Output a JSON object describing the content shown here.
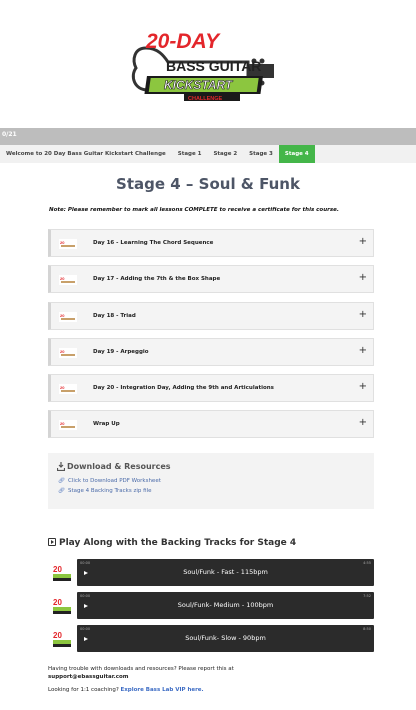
{
  "logo": {
    "line1": "20-DAY",
    "line2": "BASS GUITAR",
    "line3": "KICKSTART",
    "line4": "CHALLENGE"
  },
  "graybar": {
    "text": "0/21"
  },
  "tabs": [
    {
      "label": "Welcome to 20 Day Bass Guitar Kickstart Challenge",
      "active": false
    },
    {
      "label": "Stage 1",
      "active": false
    },
    {
      "label": "Stage 2",
      "active": false
    },
    {
      "label": "Stage 3",
      "active": false
    },
    {
      "label": "Stage 4",
      "active": true
    }
  ],
  "page": {
    "title": "Stage 4 – Soul & Funk",
    "note": "Note: Please remember to mark all lessons COMPLETE to receive a certificate for this course."
  },
  "lessons": [
    {
      "title": "Day 16 - Learning The Chord Sequence",
      "toggle": "+"
    },
    {
      "title": "Day 17 - Adding the 7th & the Box Shape",
      "toggle": "+"
    },
    {
      "title": "Day 18 - Triad",
      "toggle": "+"
    },
    {
      "title": "Day 19 - Arpeggio",
      "toggle": "+"
    },
    {
      "title": "Day 20 - Integration Day, Adding the 9th and Articulations",
      "toggle": "+"
    },
    {
      "title": "Wrap Up",
      "toggle": "+"
    }
  ],
  "resources": {
    "title": "Download & Resources",
    "links": [
      "Click to Download PDF Worksheet",
      "Stage 4 Backing Tracks zip file"
    ]
  },
  "playalong": {
    "title": "Play Along with the Backing Tracks for Stage 4"
  },
  "tracks": [
    {
      "title": "Soul/Funk - Fast - 115bpm",
      "start": "00:00",
      "end": "4:55"
    },
    {
      "title": "Soul/Funk- Medium - 100bpm",
      "start": "00:00",
      "end": "7:52"
    },
    {
      "title": "Soul/Funk- Slow - 90bpm",
      "start": "00:00",
      "end": "8:50"
    }
  ],
  "footer": {
    "trouble": "Having trouble with downloads and resources? Please report this at",
    "email": "support@ebassguitar.com",
    "coach_prefix": "Looking for 1:1 coaching?",
    "coach_link": "Explore Bass Lab VIP here."
  },
  "colors": {
    "accent_green": "#44b649",
    "title_gray": "#4d5566",
    "logo_red": "#e3262b",
    "link_blue": "#3d6cc4"
  }
}
